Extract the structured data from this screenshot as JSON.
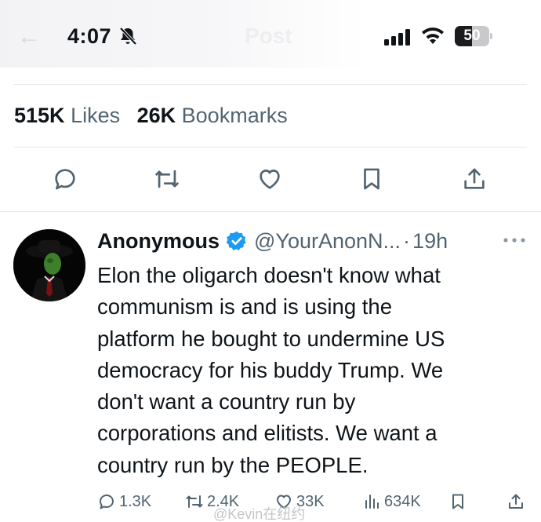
{
  "status_bar": {
    "time": "4:07",
    "battery_level": "50",
    "battery_percent": 50,
    "nav_back_glyph": "←",
    "nav_title": "Post"
  },
  "stats": {
    "likes_count": "515K",
    "likes_label": "Likes",
    "bookmarks_count": "26K",
    "bookmarks_label": "Bookmarks"
  },
  "actions": [
    {
      "name": "reply-icon"
    },
    {
      "name": "repost-icon"
    },
    {
      "name": "like-icon"
    },
    {
      "name": "bookmark-icon"
    },
    {
      "name": "share-icon"
    }
  ],
  "reply": {
    "author_name": "Anonymous",
    "author_handle": "@YourAnonN...",
    "separator": "·",
    "time_ago": "19h",
    "verified": true,
    "text": "Elon the oligarch doesn't know what\ncommunism is and is using the\nplatform he bought to undermine US\ndemocracy for his buddy Trump.  We\ndon't want a country run by\ncorporations and elitists. We want a\ncountry run by the PEOPLE.",
    "reply_count": "1.3K",
    "repost_count": "2.4K",
    "like_count": "33K",
    "view_count": "634K"
  },
  "watermark": "@Kevin在纽约",
  "colors": {
    "text_primary": "#0f1419",
    "text_secondary": "#536471",
    "verified_blue": "#1d9bf0",
    "divider": "#e6e8ea"
  }
}
